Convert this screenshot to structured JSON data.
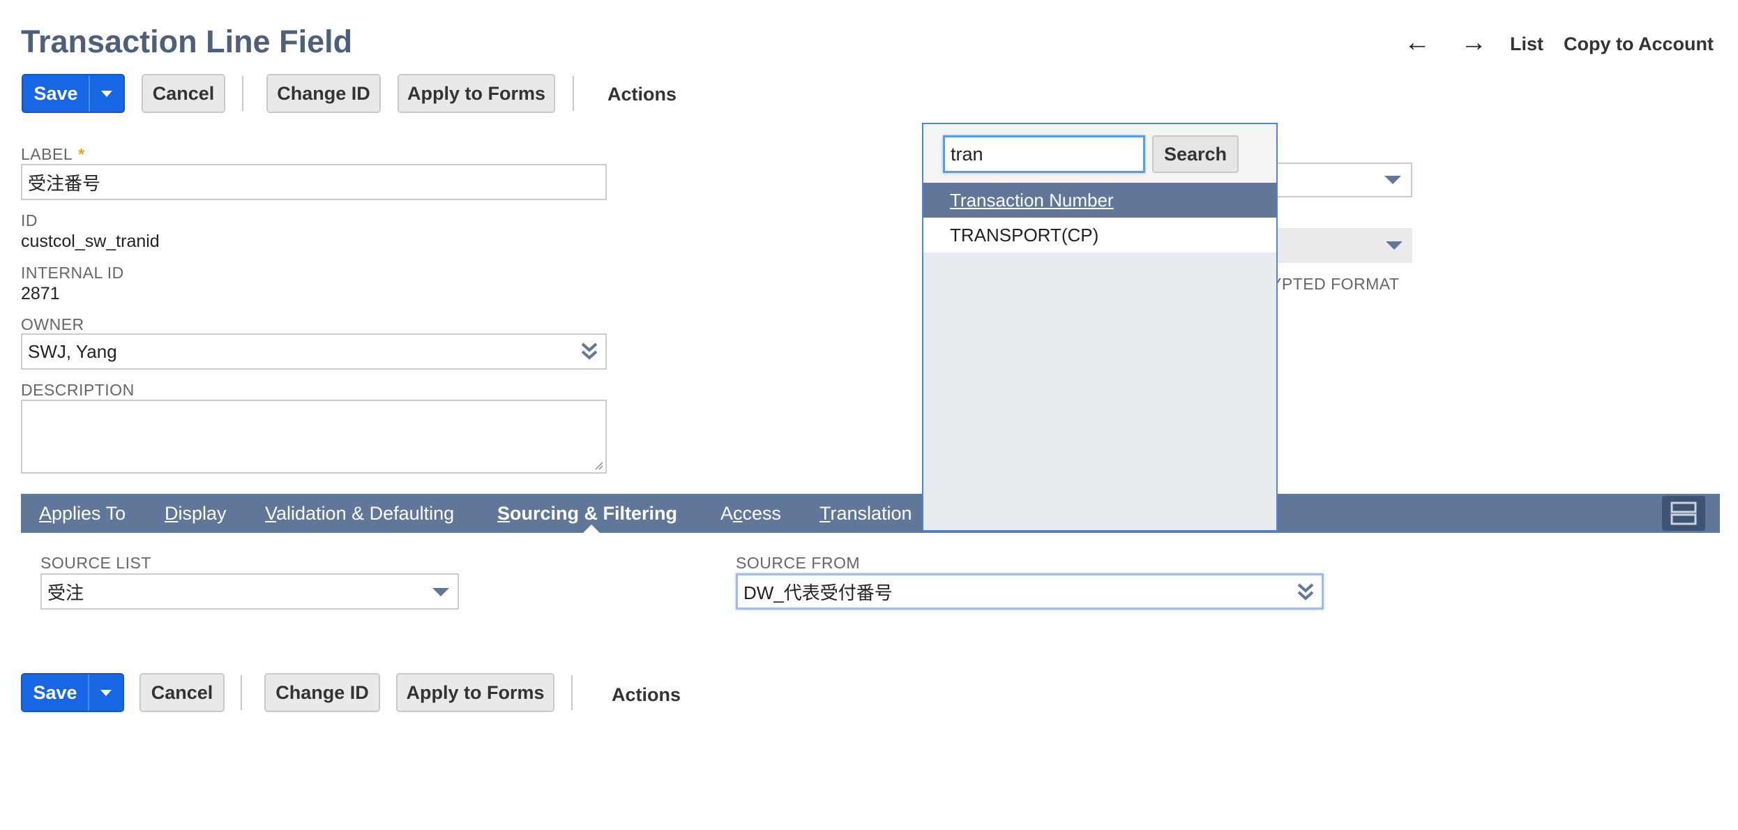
{
  "header": {
    "title": "Transaction Line Field",
    "nav": {
      "back_glyph": "←",
      "forward_glyph": "→",
      "list_label": "List",
      "copy_label": "Copy to Account"
    }
  },
  "toolbar": {
    "save_label": "Save",
    "cancel_label": "Cancel",
    "change_id_label": "Change ID",
    "apply_forms_label": "Apply to Forms",
    "actions_label": "Actions"
  },
  "form": {
    "label_caption": "LABEL",
    "label_required": "*",
    "label_value": "受注番号",
    "id_caption": "ID",
    "id_value": "custcol_sw_tranid",
    "internal_id_caption": "INTERNAL ID",
    "internal_id_value": "2871",
    "owner_caption": "OWNER",
    "owner_value": "SWJ, Yang",
    "description_caption": "DESCRIPTION",
    "description_value": "",
    "partial_caption": "YPTED FORMAT"
  },
  "tabs": [
    {
      "pre": "",
      "key": "A",
      "post": "pplies To",
      "active": false
    },
    {
      "pre": "",
      "key": "D",
      "post": "isplay",
      "active": false
    },
    {
      "pre": "",
      "key": "V",
      "post": "alidation & Defaulting",
      "active": false
    },
    {
      "pre": "",
      "key": "S",
      "post": "ourcing & Filtering",
      "active": true
    },
    {
      "pre": "A",
      "key": "c",
      "post": "cess",
      "active": false
    },
    {
      "pre": "",
      "key": "T",
      "post": "ranslation",
      "active": false
    }
  ],
  "sourcing": {
    "source_list_caption": "SOURCE LIST",
    "source_list_value": "受注",
    "source_from_caption": "SOURCE FROM",
    "source_from_value": "DW_代表受付番号"
  },
  "popup": {
    "search_value": "tran",
    "search_button": "Search",
    "results": [
      "Transaction Number",
      "TRANSPORT(CP)"
    ]
  },
  "icons": {
    "back": "left-arrow-icon",
    "forward": "right-arrow-icon",
    "save_menu": "caret-down-icon",
    "owner_select": "double-chevron-down-icon",
    "layout": "layout-rows-icon"
  },
  "colors": {
    "primary": "#1766e4",
    "tab_bar": "#607799",
    "title": "#4d5f79",
    "selected_row": "#607799",
    "required": "#e6a117"
  }
}
